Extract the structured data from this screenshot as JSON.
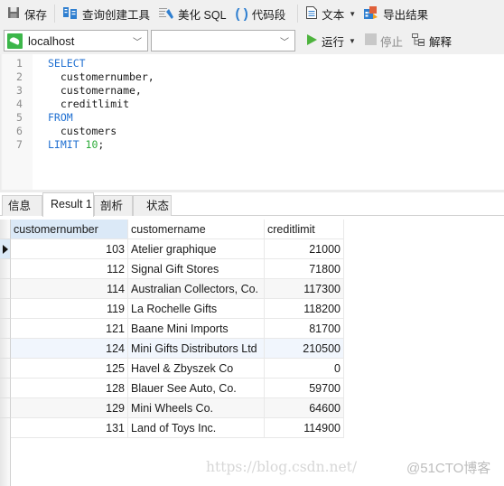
{
  "toolbar": {
    "save": "保存",
    "query_builder": "查询创建工具",
    "beautify_sql": "美化 SQL",
    "code_snippet": "代码段",
    "text": "文本",
    "export_results": "导出结果"
  },
  "toolbar2": {
    "connection": "localhost",
    "database": "",
    "run": "运行",
    "stop": "停止",
    "explain": "解释"
  },
  "editor": {
    "lines": [
      {
        "n": "1",
        "text": "SELECT"
      },
      {
        "n": "2",
        "text": "  customernumber,"
      },
      {
        "n": "3",
        "text": "  customername,"
      },
      {
        "n": "4",
        "text": "  creditlimit"
      },
      {
        "n": "5",
        "text": "FROM"
      },
      {
        "n": "6",
        "text": "  customers"
      },
      {
        "n": "7",
        "text_kw": "LIMIT ",
        "text_num": "10",
        "text_end": ";"
      }
    ]
  },
  "tabs": [
    {
      "label": "信息",
      "active": false
    },
    {
      "label": "Result 1",
      "active": true
    },
    {
      "label": "剖析",
      "active": false
    },
    {
      "label": "状态",
      "active": false
    }
  ],
  "grid": {
    "columns": [
      "customernumber",
      "customername",
      "creditlimit"
    ],
    "rows": [
      [
        "103",
        "Atelier graphique",
        "21000"
      ],
      [
        "112",
        "Signal Gift Stores",
        "71800"
      ],
      [
        "114",
        "Australian Collectors, Co.",
        "117300"
      ],
      [
        "119",
        "La Rochelle Gifts",
        "118200"
      ],
      [
        "121",
        "Baane Mini Imports",
        "81700"
      ],
      [
        "124",
        "Mini Gifts Distributors Ltd",
        "210500"
      ],
      [
        "125",
        "Havel & Zbyszek Co",
        "0"
      ],
      [
        "128",
        "Blauer See Auto, Co.",
        "59700"
      ],
      [
        "129",
        "Mini Wheels Co.",
        "64600"
      ],
      [
        "131",
        "Land of Toys Inc.",
        "114900"
      ]
    ]
  },
  "watermark": {
    "url": "https://blog.csdn.net/",
    "handle": "@51CTO博客"
  }
}
